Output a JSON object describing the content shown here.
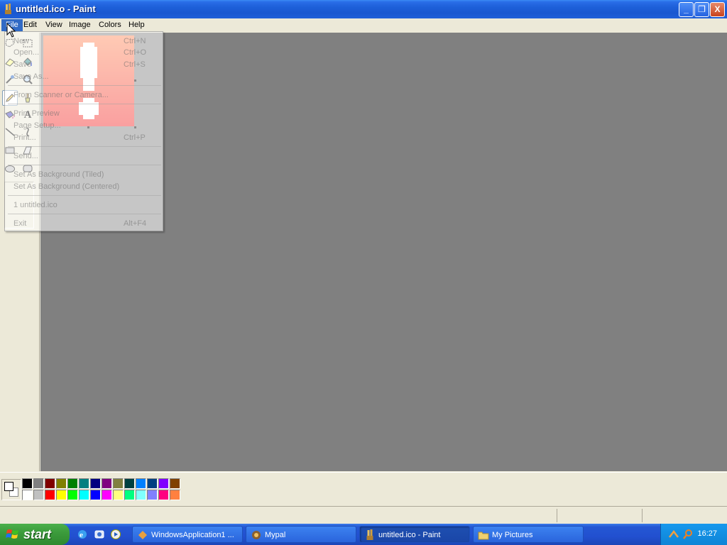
{
  "window": {
    "title": "untitled.ico - Paint",
    "minimize": "_",
    "maximize": "❐",
    "close": "X"
  },
  "menubar": {
    "items": [
      "File",
      "Edit",
      "View",
      "Image",
      "Colors",
      "Help"
    ],
    "active": "File"
  },
  "file_menu": {
    "items": [
      {
        "label": "New",
        "shortcut": "Ctrl+N"
      },
      {
        "label": "Open...",
        "shortcut": "Ctrl+O"
      },
      {
        "label": "Save",
        "shortcut": "Ctrl+S"
      },
      {
        "label": "Save As...",
        "shortcut": ""
      },
      {
        "label": "From Scanner or Camera...",
        "shortcut": ""
      },
      {
        "label": "Print Preview",
        "shortcut": ""
      },
      {
        "label": "Page Setup...",
        "shortcut": ""
      },
      {
        "label": "Print...",
        "shortcut": "Ctrl+P"
      },
      {
        "label": "Send...",
        "shortcut": ""
      },
      {
        "label": "Set As Background (Tiled)",
        "shortcut": ""
      },
      {
        "label": "Set As Background (Centered)",
        "shortcut": ""
      },
      {
        "label": "1 untitled.ico",
        "shortcut": ""
      },
      {
        "label": "Exit",
        "shortcut": "Alt+F4"
      }
    ]
  },
  "tools": [
    "free-select",
    "rect-select",
    "eraser",
    "fill",
    "color-picker",
    "magnifier",
    "pencil",
    "brush",
    "airbrush",
    "text",
    "line",
    "curve",
    "rectangle",
    "polygon",
    "ellipse",
    "rounded-rectangle"
  ],
  "selected_tool": "pencil",
  "palette": {
    "top_row": [
      "#000000",
      "#808080",
      "#800000",
      "#808000",
      "#008000",
      "#008080",
      "#000080",
      "#800080",
      "#808040",
      "#004040",
      "#0080ff",
      "#004080",
      "#8000ff",
      "#804000"
    ],
    "bottom_row": [
      "#ffffff",
      "#c0c0c0",
      "#ff0000",
      "#ffff00",
      "#00ff00",
      "#00ffff",
      "#0000ff",
      "#ff00ff",
      "#ffff80",
      "#00ff80",
      "#80ffff",
      "#8080ff",
      "#ff0080",
      "#ff8040"
    ]
  },
  "taskbar": {
    "start_label": "start",
    "tasks": [
      {
        "label": "WindowsApplication1 ...",
        "active": false
      },
      {
        "label": "Mypal",
        "active": false
      },
      {
        "label": "untitled.ico - Paint",
        "active": true
      },
      {
        "label": "My Pictures",
        "active": false
      }
    ],
    "clock": "16:27"
  }
}
